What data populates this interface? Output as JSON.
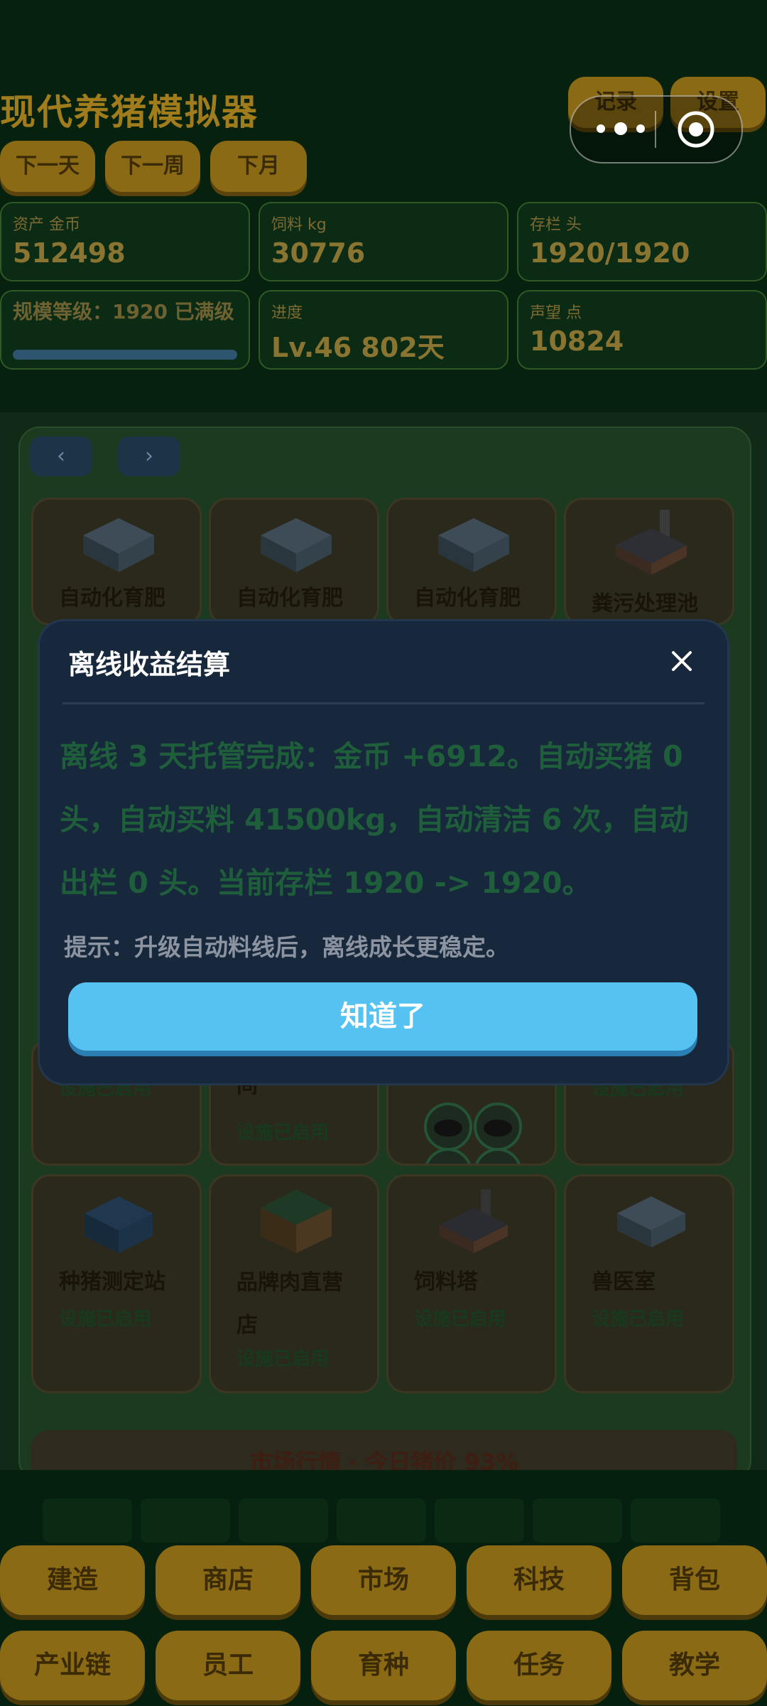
{
  "header": {
    "title": "现代养猪模拟器",
    "time_buttons": [
      "下一天",
      "下一周",
      "下月"
    ],
    "record_label": "记录",
    "settings_label": "设置"
  },
  "stats": [
    {
      "label": "资产 金币",
      "value": "512498"
    },
    {
      "label": "饲料 kg",
      "value": "30776"
    },
    {
      "label": "存栏 头",
      "value": "1920/1920"
    },
    {
      "label": "规模等级：1920 已满级",
      "value": ""
    },
    {
      "label": "进度",
      "value": "Lv.46  802天"
    },
    {
      "label": "声望 点",
      "value": "10824"
    }
  ],
  "pager": {
    "prev": "‹",
    "next": "›"
  },
  "facilities": {
    "row1": [
      {
        "name": "自动化育肥",
        "status": ""
      },
      {
        "name": "自动化育肥",
        "status": ""
      },
      {
        "name": "自动化育肥",
        "status": ""
      },
      {
        "name": "粪污处理池",
        "status": ""
      }
    ],
    "row_mid": [
      {
        "name": "",
        "status": "设施已启用"
      },
      {
        "name": "间",
        "status": "设施已启用"
      },
      {
        "name": "",
        "status": ""
      },
      {
        "name": "",
        "status": "设施已启用"
      }
    ],
    "row3": [
      {
        "name": "种猪测定站",
        "status": "设施已启用"
      },
      {
        "name": "品牌肉直营店",
        "status": "设施已启用"
      },
      {
        "name": "饲料塔",
        "status": "设施已启用"
      },
      {
        "name": "兽医室",
        "status": "设施已启用"
      }
    ]
  },
  "market_text": "市场行情 · 今日猪价 93%",
  "nav_row1": [
    "建造",
    "商店",
    "市场",
    "科技",
    "背包"
  ],
  "nav_row2": [
    "产业链",
    "员工",
    "育种",
    "任务",
    "教学"
  ],
  "modal": {
    "title": "离线收益结算",
    "body": "离线 3 天托管完成：金币 +6912。自动买猪 0 头，自动买料 41500kg，自动清洁 6 次，自动出栏 0 头。当前存栏 1920 -> 1920。",
    "tip": "提示：升级自动料线后，离线成长更稳定。",
    "confirm": "知道了"
  },
  "colors": {
    "accent_button": "#56c2f2",
    "gold_button": "#8a6a14",
    "modal_bg": "#18283c",
    "body_text": "#1e5e3b"
  }
}
